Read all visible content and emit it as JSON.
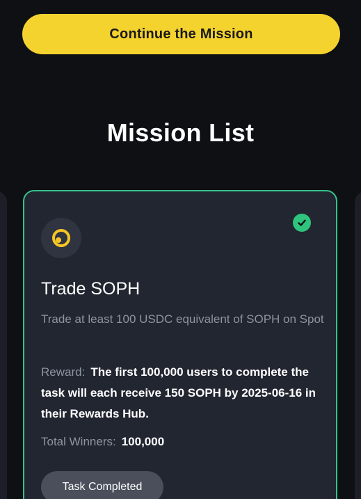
{
  "header": {
    "cta_label": "Continue the Mission"
  },
  "mission_list": {
    "title": "Mission List",
    "cards": [
      {
        "title": "Trade SOPH",
        "description": "Trade at least 100 USDC equivalent of SOPH on Spot",
        "reward_label": "Reward:",
        "reward_text": "The first 100,000 users to complete the task will each receive 150 SOPH by 2025-06-16 in their Rewards Hub.",
        "winners_label": "Total Winners:",
        "winners_value": "100,000",
        "status_label": "Task Completed",
        "completed": true,
        "token_icon": "soph-token-icon",
        "status_icon": "check-circle-icon"
      }
    ]
  },
  "colors": {
    "background": "#0e1014",
    "card": "#222631",
    "accent_yellow": "#f5d32f",
    "success_green": "#35c28a",
    "muted_text": "#8e94a0"
  }
}
